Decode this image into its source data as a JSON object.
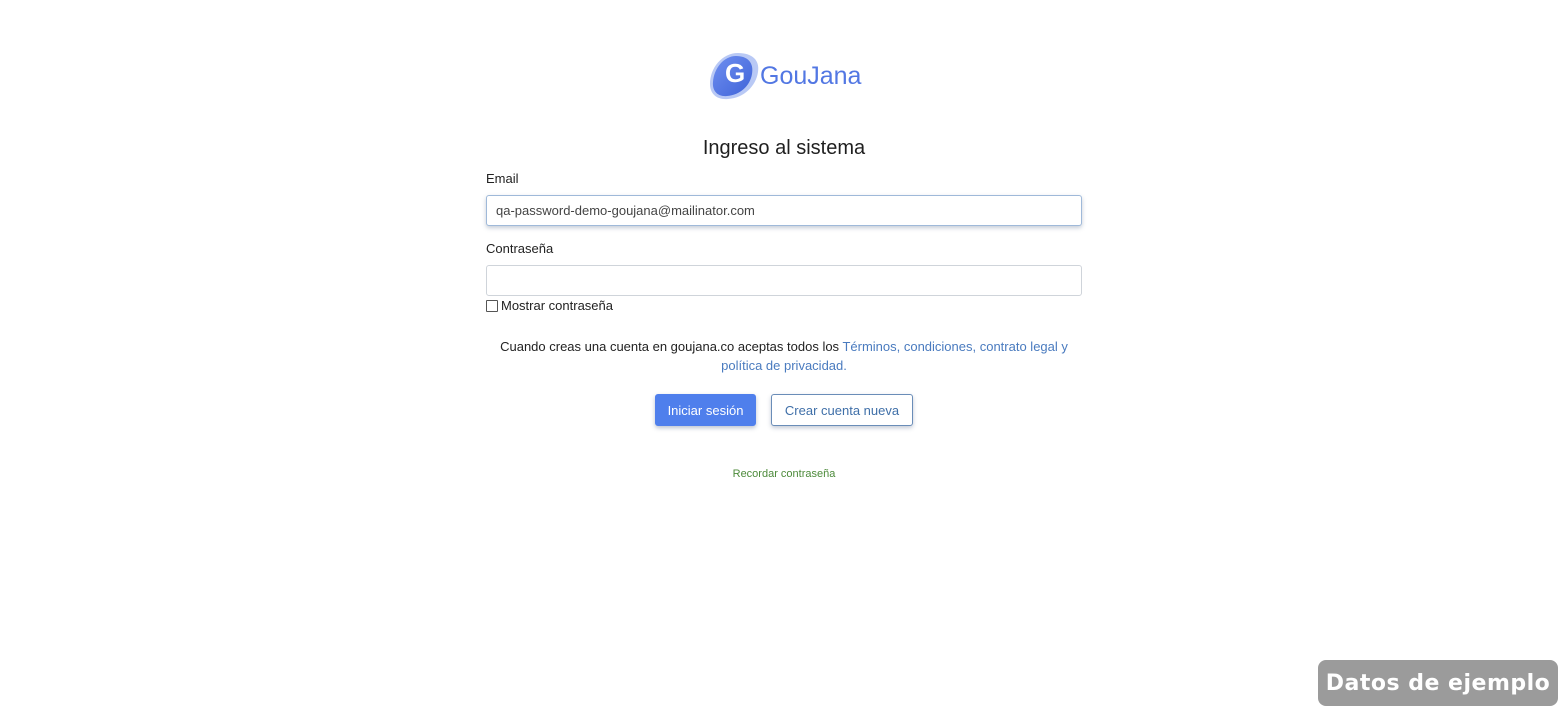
{
  "logo": {
    "letter": "G",
    "brand": "GouJana",
    "color": "#5277e3"
  },
  "login": {
    "title": "Ingreso al sistema",
    "email_label": "Email",
    "email_value": "qa-password-demo-goujana@mailinator.com",
    "password_label": "Contraseña",
    "password_value": "",
    "show_password_label": "Mostrar contraseña",
    "show_password_checked": false
  },
  "terms": {
    "text": "Cuando creas una cuenta en goujana.co aceptas todos los ",
    "link": "Términos, condiciones, contrato legal y política de privacidad."
  },
  "actions": {
    "login_label": "Iniciar sesión",
    "create_label": "Crear cuenta nueva",
    "remember_label": "Recordar contraseña"
  },
  "badge": {
    "label": "Datos de ejemplo"
  },
  "colors": {
    "primary": "#4f7fec",
    "link": "#4a7bbf",
    "remember": "#4c8a3a"
  }
}
